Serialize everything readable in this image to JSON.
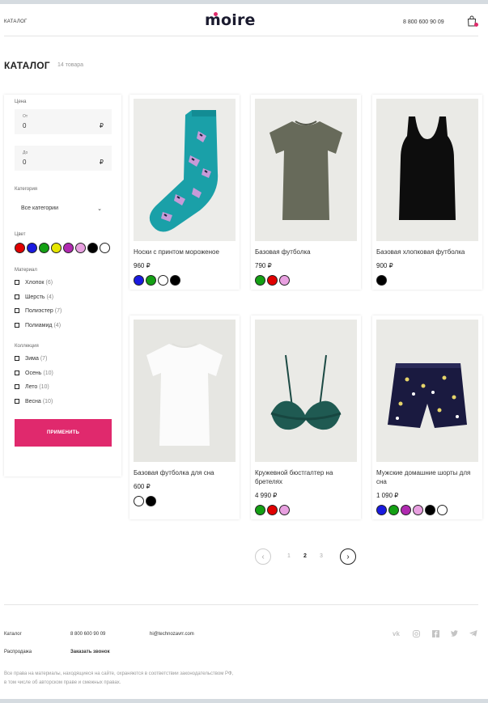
{
  "header": {
    "catalog_link": "КАТАЛОГ",
    "logo": "moire",
    "phone": "8 800 600 90 09",
    "cart_icon": "shopping-bag-icon"
  },
  "page": {
    "title": "КАТАЛОГ",
    "count": "14 товара"
  },
  "filter": {
    "price_label": "Цена",
    "from_label": "От",
    "from_value": "0",
    "to_label": "До",
    "to_value": "0",
    "currency": "₽",
    "category_label": "Категория",
    "category_value": "Все категории",
    "color_label": "Цвет",
    "colors": [
      "#e00000",
      "#1a1ae0",
      "#14a014",
      "#e6e600",
      "#b02ab0",
      "#e8a0e0",
      "#000000",
      "#ffffff"
    ],
    "material_label": "Материал",
    "materials": [
      {
        "label": "Хлопок",
        "count": "(6)"
      },
      {
        "label": "Шерсть",
        "count": "(4)"
      },
      {
        "label": "Полиэстер",
        "count": "(7)"
      },
      {
        "label": "Полиамид",
        "count": "(4)"
      }
    ],
    "collection_label": "Коллекция",
    "collections": [
      {
        "label": "Зима",
        "count": "(7)"
      },
      {
        "label": "Осень",
        "count": "(10)"
      },
      {
        "label": "Лето",
        "count": "(10)"
      },
      {
        "label": "Весна",
        "count": "(10)"
      }
    ],
    "apply_label": "ПРИМЕНИТЬ"
  },
  "products": [
    {
      "name": "Носки с принтом мороженое",
      "price": "960 ₽",
      "colors": [
        "#1a1ae0",
        "#14a014",
        "#ffffff",
        "#000000"
      ]
    },
    {
      "name": "Базовая футболка",
      "price": "790 ₽",
      "colors": [
        "#14a014",
        "#e00000",
        "#e8a0e0"
      ]
    },
    {
      "name": "Базовая хлопковая футболка",
      "price": "900 ₽",
      "colors": [
        "#000000"
      ]
    },
    {
      "name": "Базовая футболка для сна",
      "price": "600 ₽",
      "colors": [
        "#ffffff",
        "#000000"
      ]
    },
    {
      "name": "Кружевной бюстгалтер на бретелях",
      "price": "4 990 ₽",
      "colors": [
        "#14a014",
        "#e00000",
        "#e8a0e0"
      ]
    },
    {
      "name": "Мужские домашние шорты для сна",
      "price": "1 090 ₽",
      "colors": [
        "#1a1ae0",
        "#14a014",
        "#b02ab0",
        "#e8a0e0",
        "#000000",
        "#ffffff"
      ]
    }
  ],
  "pagination": {
    "pages": [
      "1",
      "2",
      "3"
    ],
    "active": "2",
    "prev_icon": "chevron-left-icon",
    "next_icon": "chevron-right-icon"
  },
  "footer": {
    "catalog": "Каталог",
    "phone": "8 800 600 90 09",
    "email": "hi@technozavrr.com",
    "sale": "Распродажа",
    "callback": "Заказать звонок",
    "social": [
      "vk-icon",
      "instagram-icon",
      "facebook-icon",
      "twitter-icon",
      "telegram-icon"
    ],
    "copyright": "Все права на материалы, находящиеся на сайте, охраняются в соответствии законодательством РФ, в том числе об авторском праве и смежных правах."
  }
}
